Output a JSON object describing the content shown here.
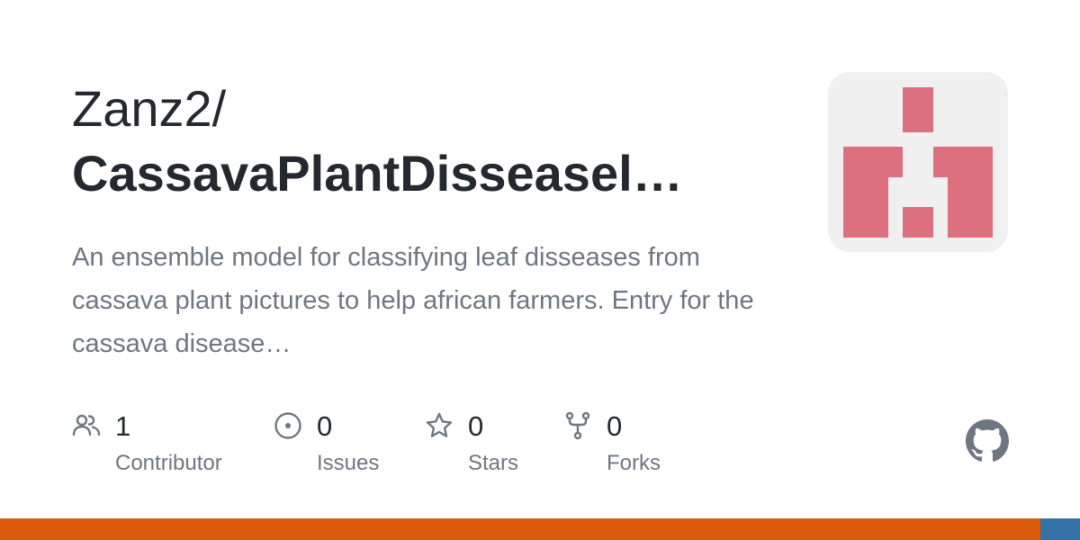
{
  "repo": {
    "owner": "Zanz2/",
    "name": "CassavaPlantDisseasel…",
    "description": "An ensemble model for classifying leaf disseases from cassava plant pictures to help african farmers. Entry for the cassava disease…"
  },
  "avatar": {
    "pattern_color": "#dc707f",
    "background": "#f0f0f0",
    "icon": "identicon"
  },
  "stats": [
    {
      "icon": "people-icon",
      "value": "1",
      "label": "Contributor"
    },
    {
      "icon": "issue-opened-icon",
      "value": "0",
      "label": "Issues"
    },
    {
      "icon": "star-icon",
      "value": "0",
      "label": "Stars"
    },
    {
      "icon": "repo-forked-icon",
      "value": "0",
      "label": "Forks"
    }
  ],
  "brand_icon": "github-mark-icon",
  "language_bar": [
    {
      "color": "#da5b0b",
      "fraction": 0.963
    },
    {
      "color": "#3572a5",
      "fraction": 0.037
    }
  ]
}
